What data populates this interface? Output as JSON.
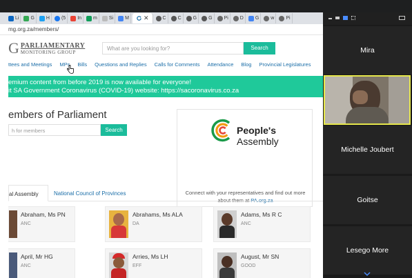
{
  "browser": {
    "tabs": [
      {
        "label": "Li",
        "color": "#0a66c2"
      },
      {
        "label": "G",
        "color": "#34a853"
      },
      {
        "label": "H",
        "color": "#1da1f2"
      },
      {
        "label": "(5",
        "color": "#1877f2"
      },
      {
        "label": "In",
        "color": "#ea4335"
      },
      {
        "label": "m",
        "color": "#0f9d58"
      },
      {
        "label": "Si",
        "color": "#888888"
      },
      {
        "label": "M",
        "color": "#4285f4"
      }
    ],
    "active_tab_icon": "refresh-icon",
    "tail_tabs": [
      "C",
      "C",
      "G",
      "G",
      "Pi",
      "D",
      "G",
      "w",
      "Pi"
    ],
    "url": "mg.org.za/members/"
  },
  "site": {
    "logo_letter": "G",
    "logo_line1": "PARLIAMENTARY",
    "logo_line2": "MONITORING GROUP",
    "search_placeholder": "What are you looking for?",
    "search_button": "Search",
    "nav": [
      "ttees and Meetings",
      "MPs",
      "Bills",
      "Questions and Replies",
      "Calls for Comments",
      "Attendance",
      "Blog",
      "Provincial Legislatures"
    ],
    "banner_line1": "emium content from before 2019 is now available for everyone!",
    "banner_line2": "it SA Government Coronavirus (COVID-19) website: https://sacoronavirus.co.za",
    "page_title": "embers of Parliament",
    "members_search_placeholder": "h for members",
    "members_search_button": "Search",
    "pa_name_line1": "People's",
    "pa_name_line2": "Assembly",
    "pa_text": "Connect with your representatives and find out more about them at ",
    "pa_link": "PA.org.za",
    "tab_assembly": "al Assembly",
    "tab_ncop": "National Council of Provinces",
    "members": [
      {
        "name": "Abraham, Ms PN",
        "party": "ANC"
      },
      {
        "name": "Abrahams, Ms ALA",
        "party": "DA"
      },
      {
        "name": "Adams, Ms R C",
        "party": "ANC"
      },
      {
        "name": "April, Mr HG",
        "party": "ANC"
      },
      {
        "name": "Arries, Ms LH",
        "party": "EFF"
      },
      {
        "name": "August, Mr SN",
        "party": "GOOD"
      }
    ]
  },
  "zoom": {
    "participants": [
      "Mira",
      "Michelle Joubert",
      "Goitse",
      "Lesego More"
    ]
  }
}
